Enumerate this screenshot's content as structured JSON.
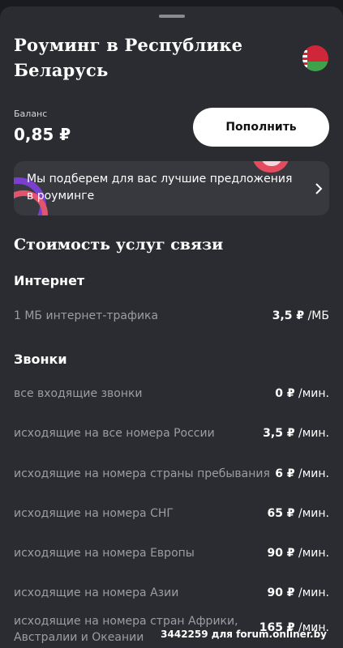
{
  "header": {
    "title_line1": "Роуминг в Республике",
    "title_line2": "Беларусь",
    "flag_icon": "belarus-flag-icon"
  },
  "balance": {
    "label": "Баланс",
    "value": "0,85 ₽",
    "topup_label": "Пополнить"
  },
  "promo": {
    "text": "Мы подберем для вас лучшие предложения в роуминге",
    "arrow_icon": "chevron-right-icon"
  },
  "pricing": {
    "title": "Стоимость услуг связи",
    "internet": {
      "title": "Интернет",
      "rows": [
        {
          "label": "1 МБ интернет-трафика",
          "price": "3,5 ₽",
          "unit": "/МБ"
        }
      ]
    },
    "calls": {
      "title": "Звонки",
      "rows": [
        {
          "label": "все входящие звонки",
          "price": "0 ₽",
          "unit": "/мин."
        },
        {
          "label": "исходящие на все номера России",
          "price": "3,5 ₽",
          "unit": "/мин."
        },
        {
          "label": "исходящие на номера страны пребывания",
          "price": "6 ₽",
          "unit": "/мин."
        },
        {
          "label": "исходящие на номера СНГ",
          "price": "65 ₽",
          "unit": "/мин."
        },
        {
          "label": "исходящие на номера Европы",
          "price": "90 ₽",
          "unit": "/мин."
        },
        {
          "label": "исходящие на номера Азии",
          "price": "90 ₽",
          "unit": "/мин."
        },
        {
          "label": "исходящие на номера стран Африки, Австралии и Океании",
          "price": "165 ₽",
          "unit": "/мин."
        }
      ]
    }
  },
  "watermark": "3442259 для forum.onliner.by",
  "colors": {
    "background": "#2b2c31",
    "card": "#38393e",
    "accent_red": "#d0263a",
    "text_muted": "#9c9da2"
  }
}
